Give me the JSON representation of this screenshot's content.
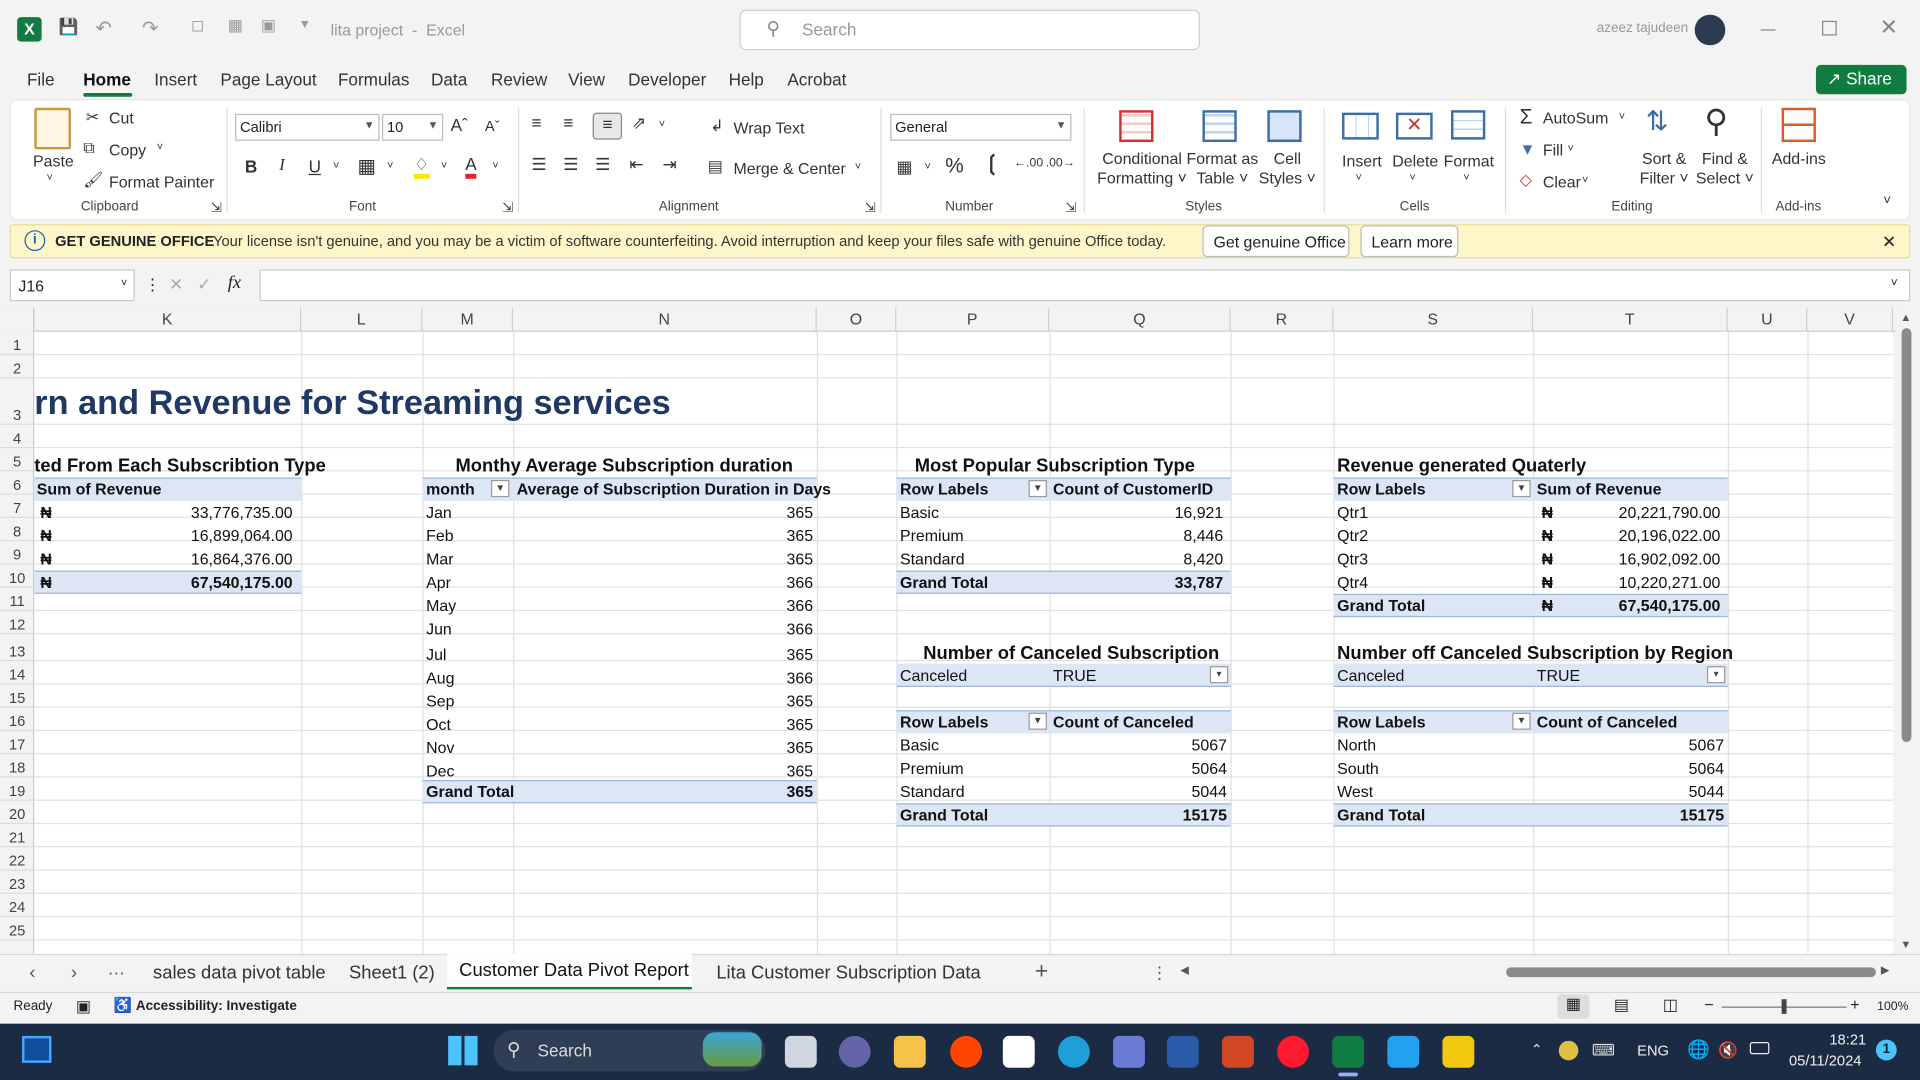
{
  "window": {
    "doc_title": "lita project",
    "app": "Excel",
    "search_placeholder": "Search",
    "user": "azeez tajudeen"
  },
  "tabs": [
    "File",
    "Home",
    "Insert",
    "Page Layout",
    "Formulas",
    "Data",
    "Review",
    "View",
    "Developer",
    "Help",
    "Acrobat"
  ],
  "share": "Share",
  "ribbon": {
    "clipboard": {
      "paste": "Paste",
      "cut": "Cut",
      "copy": "Copy",
      "format_painter": "Format Painter",
      "label": "Clipboard"
    },
    "font": {
      "name": "Calibri",
      "size": "10",
      "bold": "B",
      "italic": "I",
      "underline": "U",
      "label": "Font"
    },
    "alignment": {
      "wrap": "Wrap Text",
      "merge": "Merge & Center",
      "label": "Alignment"
    },
    "number": {
      "format": "General",
      "label": "Number"
    },
    "styles": {
      "cond1": "Conditional",
      "cond2": "Formatting",
      "fmt1": "Format as",
      "fmt2": "Table",
      "cell1": "Cell",
      "cell2": "Styles",
      "label": "Styles"
    },
    "cells": {
      "insert": "Insert",
      "delete": "Delete",
      "format": "Format",
      "label": "Cells"
    },
    "editing": {
      "autosum": "AutoSum",
      "fill": "Fill",
      "clear": "Clear",
      "sort1": "Sort &",
      "sort2": "Filter",
      "find1": "Find &",
      "find2": "Select",
      "label": "Editing"
    },
    "addins": {
      "btn": "Add-ins",
      "label": "Add-ins"
    }
  },
  "infobar": {
    "title": "GET GENUINE OFFICE",
    "message": "Your license isn't genuine, and you may be a victim of software counterfeiting. Avoid interruption and keep your files safe with genuine Office today.",
    "btn1": "Get genuine Office",
    "btn2": "Learn more"
  },
  "formula": {
    "namebox": "J16",
    "fx": "fx"
  },
  "columns": [
    "K",
    "L",
    "M",
    "N",
    "O",
    "P",
    "Q",
    "R",
    "S",
    "T",
    "U",
    "V"
  ],
  "rows": [
    "1",
    "2",
    "3",
    "4",
    "5",
    "6",
    "7",
    "8",
    "9",
    "10",
    "11",
    "12",
    "13",
    "14",
    "15",
    "16",
    "17",
    "18",
    "19",
    "20",
    "21",
    "22",
    "23",
    "24",
    "25"
  ],
  "sheet": {
    "title": "rn and Revenue for  Streaming services",
    "t1": {
      "title": "ted From Each Subscribtion Type",
      "header": "Sum of Revenue",
      "currency": "₦",
      "values": [
        "33,776,735.00",
        "16,899,064.00",
        "16,864,376.00"
      ],
      "total": "67,540,175.00"
    },
    "t2": {
      "title": "Monthy Average Subscription duration",
      "col1": "month",
      "col2": "Average of Subscription Duration in Days",
      "rows": [
        [
          "Jan",
          "365"
        ],
        [
          "Feb",
          "365"
        ],
        [
          "Mar",
          "365"
        ],
        [
          "Apr",
          "366"
        ],
        [
          "May",
          "366"
        ],
        [
          "Jun",
          "366"
        ],
        [
          "Jul",
          "365"
        ],
        [
          "Aug",
          "366"
        ],
        [
          "Sep",
          "365"
        ],
        [
          "Oct",
          "365"
        ],
        [
          "Nov",
          "365"
        ],
        [
          "Dec",
          "365"
        ]
      ],
      "total_label": "Grand Total",
      "total": "365"
    },
    "t3": {
      "title": "Most Popular Subscription Type",
      "col1": "Row Labels",
      "col2": "Count of CustomerID",
      "rows": [
        [
          "Basic",
          "16,921"
        ],
        [
          "Premium",
          "8,446"
        ],
        [
          "Standard",
          "8,420"
        ]
      ],
      "total_label": "Grand Total",
      "total": "33,787"
    },
    "t4": {
      "title": "Revenue generated Quaterly",
      "col1": "Row Labels",
      "col2": "Sum of Revenue",
      "currency": "₦",
      "rows": [
        [
          "Qtr1",
          "20,221,790.00"
        ],
        [
          "Qtr2",
          "20,196,022.00"
        ],
        [
          "Qtr3",
          "16,902,092.00"
        ],
        [
          "Qtr4",
          "10,220,271.00"
        ]
      ],
      "total_label": "Grand Total",
      "total": "67,540,175.00"
    },
    "t5": {
      "title": "Number of Canceled Subscription",
      "filter_label": "Canceled",
      "filter_value": "TRUE",
      "col1": "Row Labels",
      "col2": "Count of Canceled",
      "rows": [
        [
          "Basic",
          "5067"
        ],
        [
          "Premium",
          "5064"
        ],
        [
          "Standard",
          "5044"
        ]
      ],
      "total_label": "Grand Total",
      "total": "15175"
    },
    "t6": {
      "title": "Number off Canceled  Subscription by Region",
      "filter_label": "Canceled",
      "filter_value": "TRUE",
      "col1": "Row Labels",
      "col2": "Count of Canceled",
      "rows": [
        [
          "North",
          "5067"
        ],
        [
          "South",
          "5064"
        ],
        [
          "West",
          "5044"
        ]
      ],
      "total_label": "Grand Total",
      "total": "15175"
    }
  },
  "sheet_tabs": [
    "sales data pivot table",
    "Sheet1 (2)",
    "Customer Data Pivot Report",
    "Lita Customer Subscription Data"
  ],
  "status": {
    "ready": "Ready",
    "accessibility": "Accessibility: Investigate",
    "zoom": "100%"
  },
  "taskbar": {
    "search": "Search",
    "lang": "ENG",
    "time": "18:21",
    "date": "05/11/2024",
    "badge": "1"
  }
}
